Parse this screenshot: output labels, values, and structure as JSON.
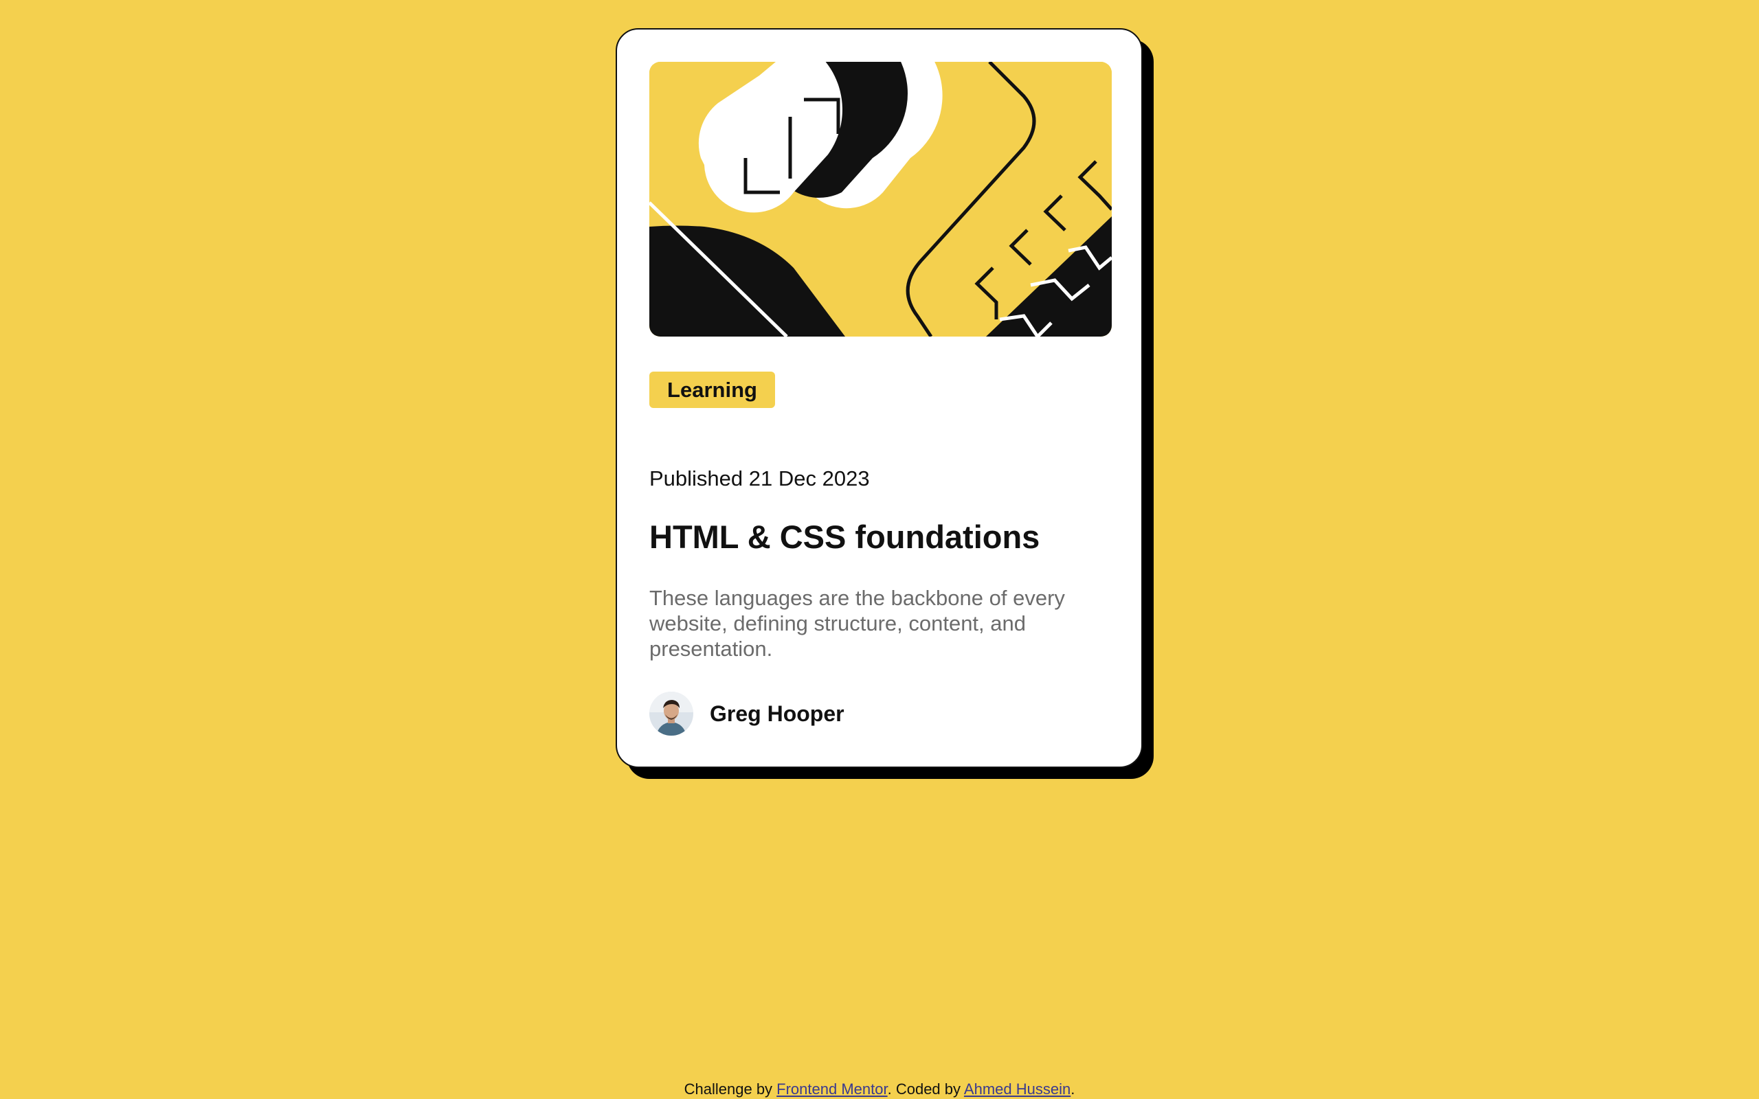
{
  "card": {
    "category_tag": "Learning",
    "published": "Published 21 Dec 2023",
    "title": "HTML & CSS foundations",
    "description": "These languages are the backbone of every website, defining structure, content, and presentation.",
    "author": {
      "name": "Greg Hooper"
    },
    "hero_image": "blog-illustration"
  },
  "footer": {
    "prefix": "Challenge by ",
    "challenge_link": "Frontend Mentor",
    "middle": ". Coded by ",
    "author_link": "Ahmed Hussein",
    "suffix": "."
  },
  "colors": {
    "background": "#F4D04E",
    "card": "#FFFFFF",
    "text": "#111111",
    "muted_text": "#6B6B6B",
    "shadow": "#000000"
  }
}
